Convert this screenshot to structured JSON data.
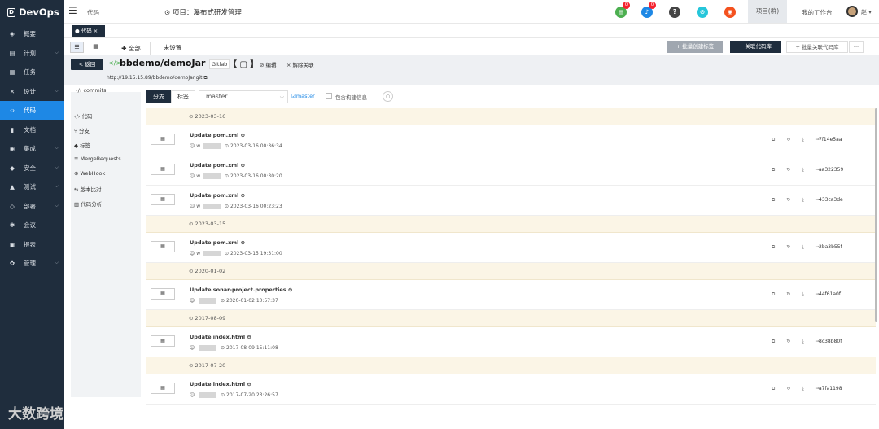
{
  "app": {
    "logo": "DevOps"
  },
  "sidebar": {
    "items": [
      {
        "label": "概要",
        "icon": "dashboard-icon",
        "glyph": "◈"
      },
      {
        "label": "计划",
        "icon": "plan-icon",
        "glyph": "▤"
      },
      {
        "label": "任务",
        "icon": "task-icon",
        "glyph": "▦"
      },
      {
        "label": "设计",
        "icon": "design-icon",
        "glyph": "✕"
      },
      {
        "label": "代码",
        "icon": "code-icon",
        "glyph": "‹›"
      },
      {
        "label": "文档",
        "icon": "doc-icon",
        "glyph": "▮"
      },
      {
        "label": "集成",
        "icon": "integration-icon",
        "glyph": "◉"
      },
      {
        "label": "安全",
        "icon": "shield-icon",
        "glyph": "◆"
      },
      {
        "label": "测试",
        "icon": "test-icon",
        "glyph": "▲"
      },
      {
        "label": "部署",
        "icon": "deploy-icon",
        "glyph": "◇"
      },
      {
        "label": "会议",
        "icon": "meeting-icon",
        "glyph": "✱"
      },
      {
        "label": "报表",
        "icon": "report-icon",
        "glyph": "▣"
      },
      {
        "label": "管理",
        "icon": "gear-icon",
        "glyph": "✿"
      }
    ]
  },
  "topbar": {
    "crumb": "代码",
    "project_label": "⊙ 项目：瀑布式研发管理",
    "project_btn": "项目(群)",
    "workbench": "我的工作台",
    "user": "赵 ▾",
    "badge1": "0",
    "badge2": "0",
    "icon_help": "?",
    "icon_link": "⊘",
    "icon_chrome": "◉"
  },
  "tab": {
    "label": "● 代码  ×"
  },
  "toolbar": {
    "view_list": "☰",
    "view_grid": "▦",
    "all_tab": "✚ 全部",
    "unset_tab": "未设置",
    "batch_tag": "+ 批量创建标签",
    "link_repo": "+ 关联代码库",
    "batch_unlink": "+ 批量关联代码库",
    "more": "···"
  },
  "repo": {
    "back": "< 返回",
    "icon": "</>",
    "name": "bbdemo/demoJar",
    "source": "Gitlab",
    "brackets": "【 ▢ 】",
    "edit": "⊘ 编辑",
    "unlink": "× 解除关联",
    "url": "http://19.15.15.89/bbdemo/demoJar.git ⧉"
  },
  "subnav": {
    "items": [
      "‹/› commits",
      "‹/› 代码",
      "⑂ 分支",
      "◆ 标签",
      "≡ MergeRequests",
      "⊕ WebHook",
      "⇆ 版本比对",
      "▥ 代码分析"
    ]
  },
  "filter": {
    "branch_tab": "分支",
    "tag_tab": "标签",
    "branch": "master",
    "branch_arrow": "⌵",
    "master_link": "☑master",
    "include_build": "包含构建信息",
    "search": "○"
  },
  "commits": {
    "groups": [
      {
        "date": "⊙ 2023-03-16",
        "items": [
          {
            "btn": "▦",
            "title": "Update pom.xml ⊖",
            "time": "⊙ 2023-03-16 00:36:34",
            "sha": "7f14e5aa",
            "user": "w"
          },
          {
            "btn": "▦",
            "title": "Update pom.xml ⊖",
            "time": "⊙ 2023-03-16 00:30:20",
            "sha": "aa322359",
            "user": "w"
          },
          {
            "btn": "▦",
            "title": "Update pom.xml ⊖",
            "time": "⊙ 2023-03-16 00:23:23",
            "sha": "433ca3de",
            "user": "w"
          }
        ]
      },
      {
        "date": "⊙ 2023-03-15",
        "items": [
          {
            "btn": "▦",
            "title": "Update pom.xml ⊖",
            "time": "⊙ 2023-03-15 19:31:00",
            "sha": "2ba3b55f",
            "user": "w"
          }
        ]
      },
      {
        "date": "⊙ 2020-01-02",
        "items": [
          {
            "btn": "▦",
            "title": "Update sonar-project.properties ⊖",
            "time": "⊙ 2020-01-02 10:57:37",
            "sha": "44f61a0f",
            "user": ""
          }
        ]
      },
      {
        "date": "⊙ 2017-08-09",
        "items": [
          {
            "btn": "▦",
            "title": "Update index.html ⊖",
            "time": "⊙ 2017-08-09 15:11:08",
            "sha": "8c38b80f",
            "user": ""
          }
        ]
      },
      {
        "date": "⊙ 2017-07-20",
        "items": [
          {
            "btn": "▦",
            "title": "Update index.html ⊖",
            "time": "⊙ 2017-07-20 23:26:57",
            "sha": "a7fa1198",
            "user": ""
          }
        ]
      }
    ],
    "row_actions": "⧉ ↻ ⤓ ⊸"
  },
  "watermark": "大数跨境"
}
